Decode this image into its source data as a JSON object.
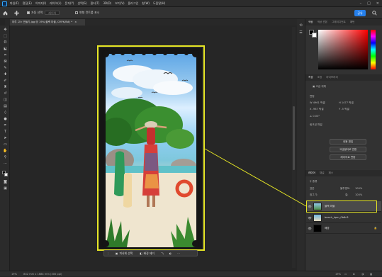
{
  "app": {
    "logo_text": "Ps",
    "menu": [
      "파일(F)",
      "편집(E)",
      "이미지(I)",
      "레이어(L)",
      "문자(Y)",
      "선택(S)",
      "필터(T)",
      "3D(D)",
      "보기(V)",
      "플러그인",
      "창(W)",
      "도움말(H)"
    ],
    "window_controls": [
      "–",
      "□",
      "✕"
    ]
  },
  "options_bar": {
    "home_icon": "home-icon",
    "move_tool_icon": "move-icon",
    "auto_select_label": "자동 선택:",
    "auto_select_value": "레이어",
    "show_transform_label": "변형 컨트롤 표시",
    "share_label": "공유",
    "search_icon": "search-icon"
  },
  "document": {
    "tab_title": "마루 고스 만들기.jpg @ 19%(블랙 마블, CMYK/8#) *",
    "tab_close": "×"
  },
  "context_bar": {
    "select_subject": "피사체 선택",
    "remove_bg": "배경 제거",
    "more": "···"
  },
  "status": {
    "zoom": "19%",
    "size": "842 mm x 1684 mm (300 ppi)"
  },
  "color_panel": {
    "tabs": [
      "색상",
      "색상 견본",
      "그레이디언트",
      "패턴"
    ],
    "foreground": "#000000",
    "background": "#ffffff"
  },
  "properties_panel": {
    "tabs": [
      "속성",
      "조정",
      "라이브러리"
    ],
    "layer_type": "고급 개체",
    "transform_header": "변형",
    "w": "4961 픽셀",
    "h": "1477 픽셀",
    "x": "-987 픽셀",
    "y": "-5 픽셀",
    "angle": "0.00°",
    "linked_label": "링크된 파일",
    "buttons": [
      "내용 편집",
      "고급필터로 변환",
      "레이어로 변환"
    ]
  },
  "layers_panel": {
    "tabs": [
      "레이어",
      "채널",
      "패스"
    ],
    "filter_label": "종류",
    "blend_mode": "표준",
    "opacity_label": "불투명도:",
    "opacity": "100%",
    "lock_label": "잠그기:",
    "fill_label": "칠:",
    "fill": "100%",
    "layers": [
      {
        "name": "블랙 마블",
        "selected": true
      },
      {
        "name": "beach_kpm_0b6c3",
        "selected": false
      },
      {
        "name": "배경",
        "selected": false
      }
    ]
  }
}
